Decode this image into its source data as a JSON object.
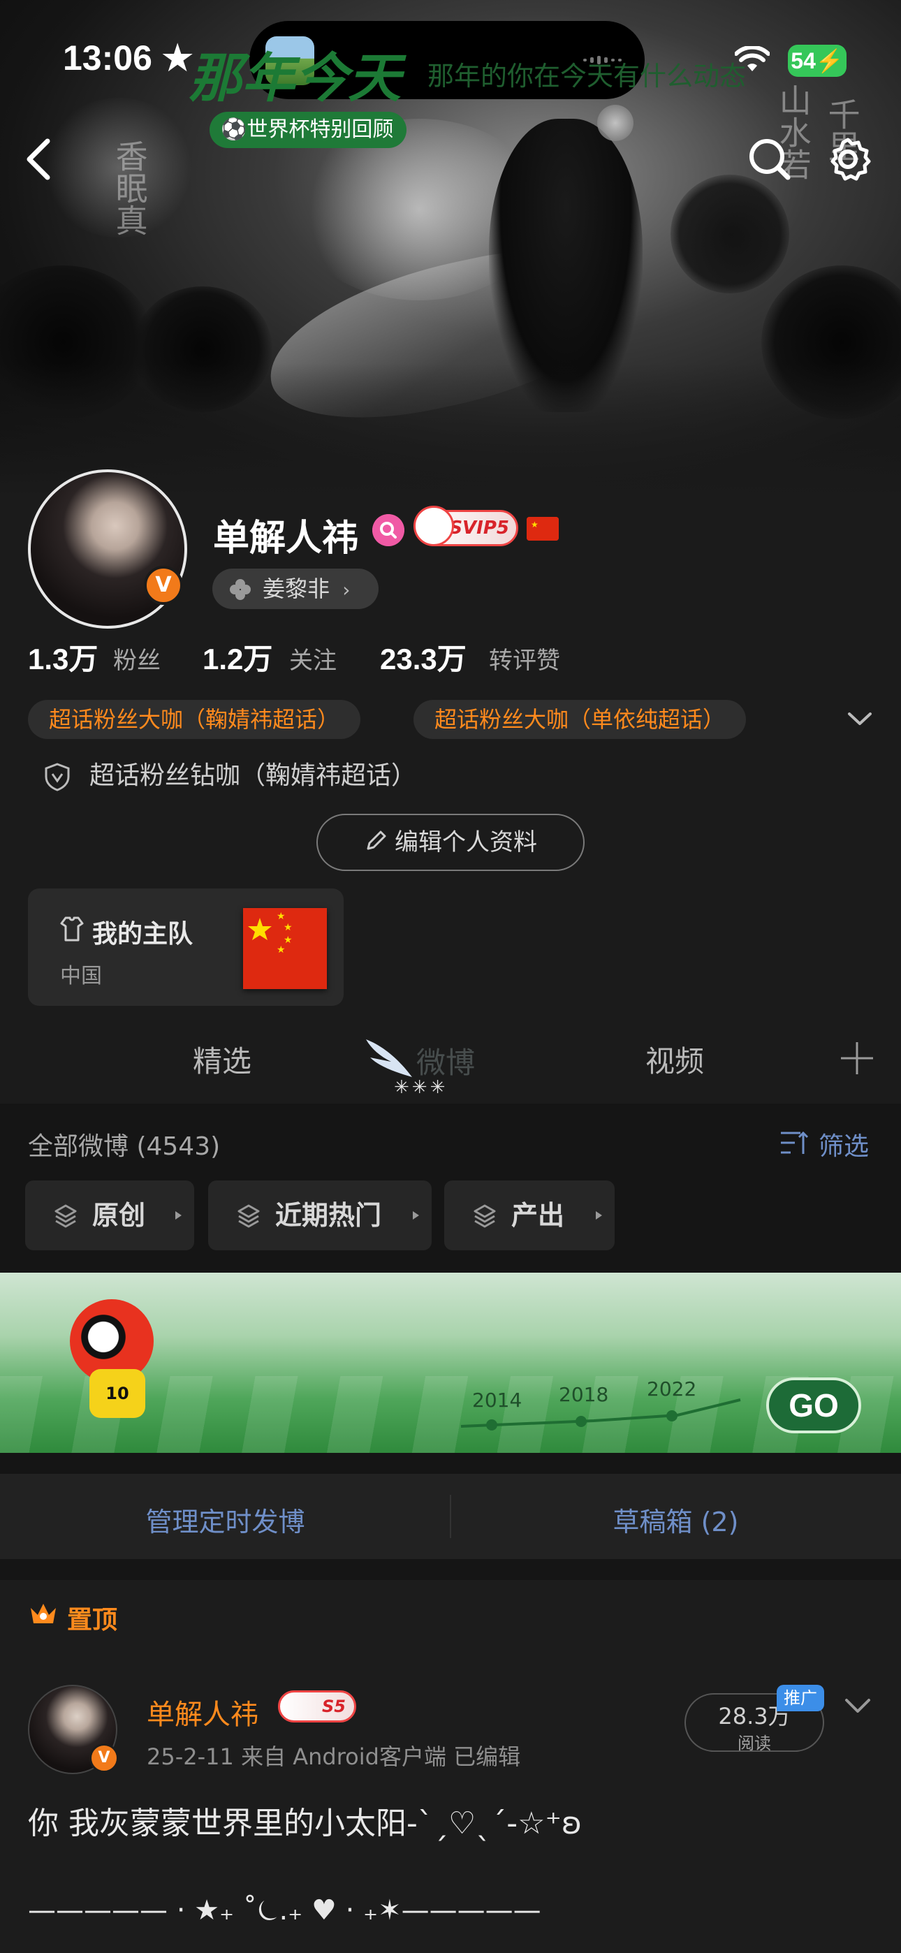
{
  "status_bar": {
    "time": "13:06 ★",
    "battery": "54⚡"
  },
  "header": {
    "back_icon": "chevron-left-icon",
    "search_icon": "search-icon",
    "settings_icon": "gear-icon"
  },
  "profile": {
    "name": "单解人祎",
    "badge": "V",
    "svip_label": "SVIP5",
    "fan_group": "姜黎非",
    "stats": [
      {
        "value": "1.3万",
        "label": "粉丝"
      },
      {
        "value": "1.2万",
        "label": "关注"
      },
      {
        "value": "23.3万",
        "label": "转评赞"
      }
    ],
    "tags": [
      "超话粉丝大咖（鞠婧祎超话）",
      "超话粉丝大咖（单依纯超话）"
    ],
    "diamond_tag": "超话粉丝钻咖（鞠婧祎超话）",
    "edit_button": "编辑个人资料",
    "team": {
      "title": "我的主队",
      "subtitle": "中国"
    }
  },
  "tabs": [
    {
      "label": "精选"
    },
    {
      "label": "微博"
    },
    {
      "label": "视频"
    }
  ],
  "feed": {
    "count_label": "全部微博 (4543)",
    "filter_label": "筛选",
    "chips": [
      "原创",
      "近期热门",
      "产出"
    ]
  },
  "promo": {
    "title": "那年今天",
    "subtitle": "那年的你在今天有什么动态",
    "pill": "⚽世界杯特别回顾",
    "years": [
      "2014",
      "2018",
      "2022"
    ],
    "go": "GO",
    "jersey": "10"
  },
  "manage": {
    "left": "管理定时发博",
    "right": "草稿箱 (2)"
  },
  "post": {
    "pinned_label": "置顶",
    "author": "单解人祎",
    "author_badge": "S5",
    "meta": "25-2-11  来自 Android客户端  已编辑",
    "reads_value": "28.3万",
    "reads_label": "阅读",
    "promo_tag": "推广",
    "text": "你 我灰蒙蒙世界里的小太阳-ˋˏ♡ˎˊ-☆⁺ʚ",
    "deco_line": "————— · ★₊ ˚⏾.₊ ♥ · ₊✶—————"
  },
  "colors": {
    "accent_orange": "#ff8a1d",
    "link_blue": "#6f8fc8",
    "battery_green": "#35c759"
  }
}
